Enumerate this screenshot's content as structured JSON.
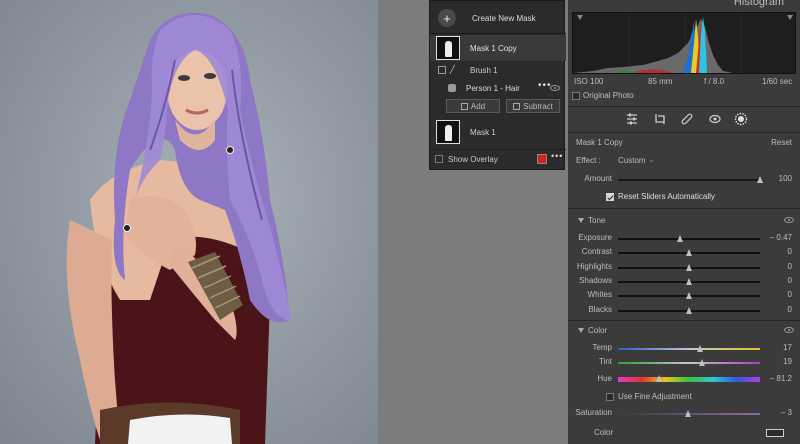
{
  "histogram": {
    "title": "Histogram",
    "iso": "ISO 100",
    "focal": "85 mm",
    "aperture": "f / 8.0",
    "shutter": "1/60 sec",
    "original_photo_label": "Original Photo"
  },
  "mask_panel": {
    "create_label": "Create New Mask",
    "masks": [
      {
        "name": "Mask 1 Copy",
        "selected": true
      },
      {
        "name": "Mask 1",
        "selected": false
      }
    ],
    "components": [
      {
        "name": "Brush 1",
        "icon": "brush-icon"
      },
      {
        "name": "Person 1 - Hair",
        "icon": "person-icon"
      }
    ],
    "add_label": "Add",
    "subtract_label": "Subtract",
    "show_overlay_label": "Show Overlay",
    "overlay_color": "#d42318"
  },
  "mask_header": {
    "name": "Mask 1 Copy",
    "reset_label": "Reset",
    "effect_label": "Effect :",
    "effect_value": "Custom",
    "amount_label": "Amount",
    "amount_value": "100",
    "amount_pos": 1.0,
    "reset_sliders_label": "Reset Sliders Automatically",
    "reset_sliders_checked": true
  },
  "tone": {
    "title": "Tone",
    "sliders": [
      {
        "label": "Exposure",
        "value": "– 0.47",
        "pos": 0.44
      },
      {
        "label": "Contrast",
        "value": "0",
        "pos": 0.5
      },
      {
        "label": "Highlights",
        "value": "0",
        "pos": 0.5
      },
      {
        "label": "Shadows",
        "value": "0",
        "pos": 0.5
      },
      {
        "label": "Whites",
        "value": "0",
        "pos": 0.5
      },
      {
        "label": "Blacks",
        "value": "0",
        "pos": 0.5
      }
    ]
  },
  "color": {
    "title": "Color",
    "temp": {
      "label": "Temp",
      "value": "17",
      "pos": 0.58
    },
    "tint": {
      "label": "Tint",
      "value": "19",
      "pos": 0.59
    },
    "hue": {
      "label": "Hue",
      "value": "– 81.2",
      "pos": 0.29
    },
    "fine_adjust_label": "Use Fine Adjustment",
    "saturation": {
      "label": "Saturation",
      "value": "– 3",
      "pos": 0.49
    },
    "color_label": "Color"
  },
  "tools": [
    {
      "icon": "sliders-icon"
    },
    {
      "icon": "crop-rotate-icon"
    },
    {
      "icon": "healing-icon"
    },
    {
      "icon": "redeye-icon"
    },
    {
      "icon": "masking-icon"
    }
  ]
}
